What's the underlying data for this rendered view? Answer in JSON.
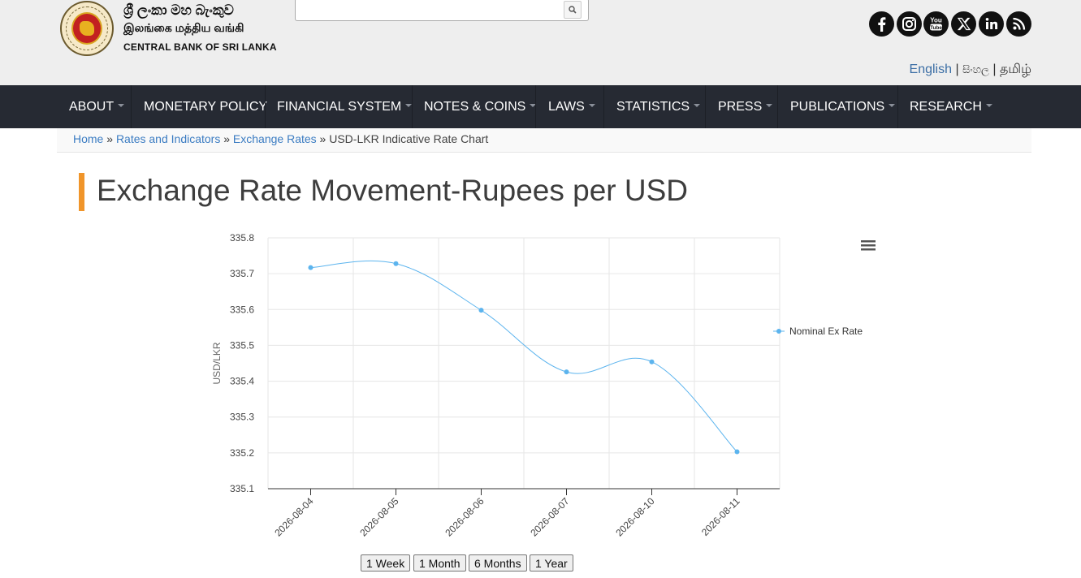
{
  "header": {
    "logo_sinhala": "ශ්‍රී ලංකා මහ බැංකුව",
    "logo_tamil": "இலங்கை மத்திய வங்கி",
    "logo_english": "CENTRAL BANK OF SRI LANKA",
    "search": {
      "value": "",
      "placeholder": ""
    },
    "social": [
      "facebook-icon",
      "instagram-icon",
      "youtube-icon",
      "x-icon",
      "linkedin-icon",
      "rss-icon"
    ],
    "youtube_label": "You Tube",
    "languages": [
      "English",
      "සිංහල",
      "தமிழ்"
    ],
    "lang_separator": "|"
  },
  "nav": {
    "items": [
      {
        "label": "ABOUT",
        "has_caret": true
      },
      {
        "label": "MONETARY POLICY",
        "has_caret": false
      },
      {
        "label": "FINANCIAL SYSTEM",
        "has_caret": true
      },
      {
        "label": "NOTES & COINS",
        "has_caret": true
      },
      {
        "label": "LAWS",
        "has_caret": true
      },
      {
        "label": "STATISTICS",
        "has_caret": true
      },
      {
        "label": "PRESS",
        "has_caret": true
      },
      {
        "label": "PUBLICATIONS",
        "has_caret": true
      },
      {
        "label": "RESEARCH",
        "has_caret": true
      }
    ]
  },
  "breadcrumb": {
    "links": [
      "Home",
      "Rates and Indicators",
      "Exchange Rates"
    ],
    "separator": "»",
    "current": "USD-LKR Indicative Rate Chart"
  },
  "page": {
    "title": "Exchange Rate Movement-Rupees per USD"
  },
  "range_buttons": [
    "1 Week",
    "1 Month",
    "6 Months",
    "1 Year"
  ],
  "colors": {
    "nav_bg": "#262a33",
    "accent": "#f0952a",
    "link": "#3b7cc2",
    "series": "#5cb4ee"
  },
  "chart_data": {
    "type": "line",
    "title": "",
    "xlabel": "",
    "ylabel": "USD/LKR",
    "categories": [
      "2026-08-04",
      "2026-08-05",
      "2026-08-06",
      "2026-08-07",
      "2026-08-10",
      "2026-08-11"
    ],
    "series": [
      {
        "name": "Nominal Ex Rate",
        "values": [
          335.717,
          335.728,
          335.598,
          335.426,
          335.454,
          335.203
        ]
      }
    ],
    "ylim": [
      335.1,
      335.8
    ],
    "yticks": [
      "335.8",
      "335.7",
      "335.6",
      "335.5",
      "335.4",
      "335.3",
      "335.2",
      "335.1"
    ],
    "grid": true,
    "legend": "right",
    "smooth": true,
    "menu_icon": "hamburger-menu-icon"
  }
}
